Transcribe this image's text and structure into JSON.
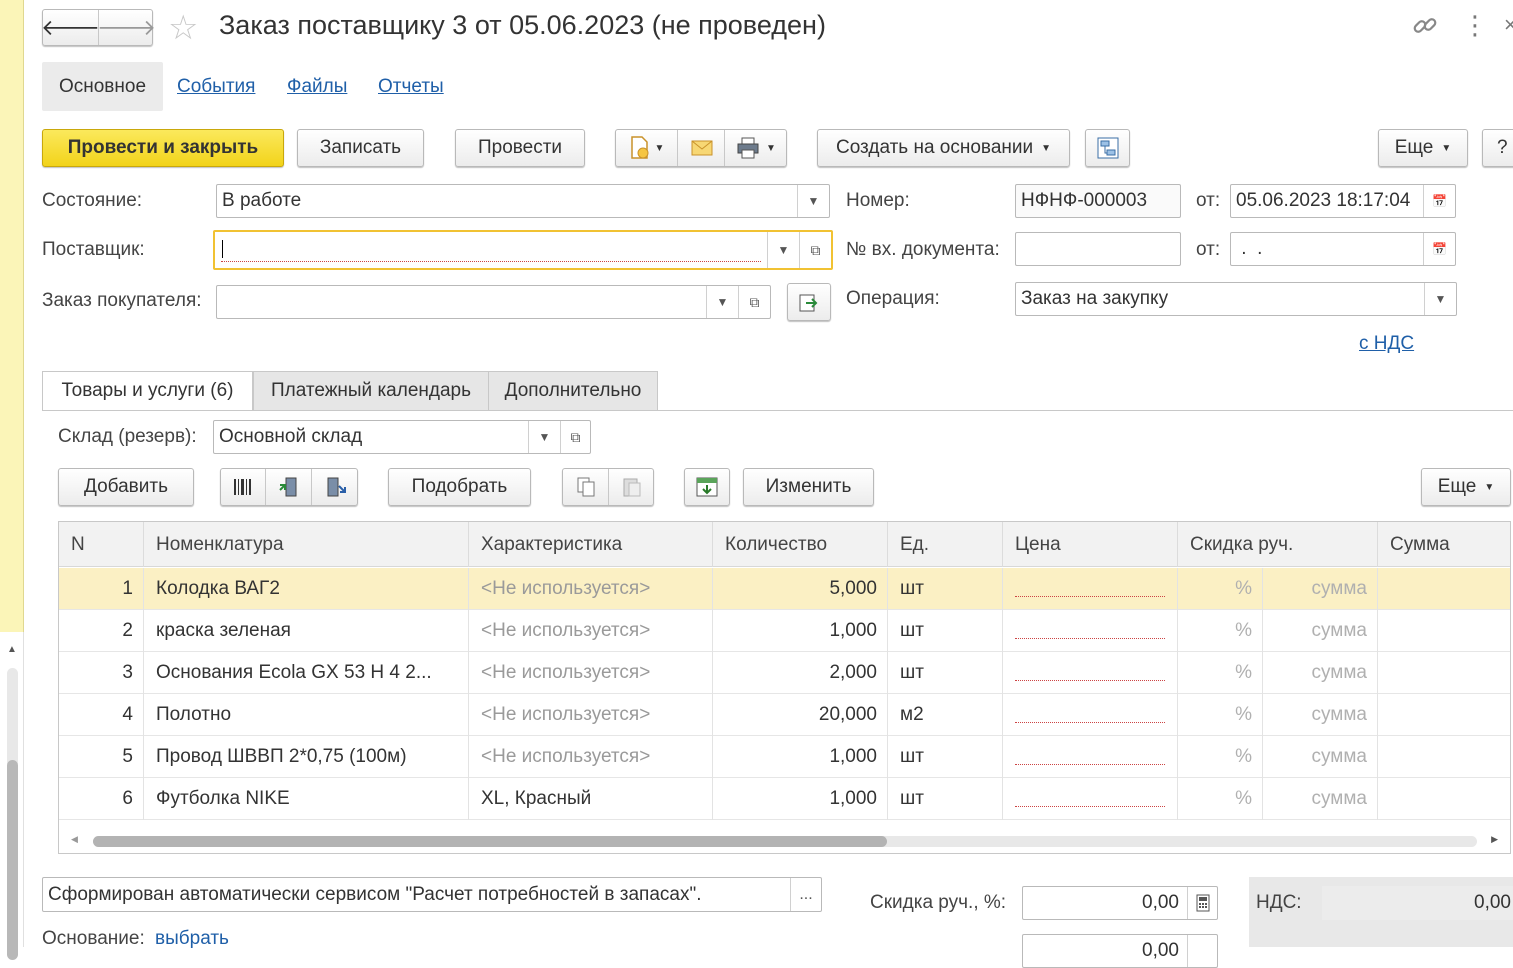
{
  "window": {
    "title": "Заказ поставщику 3 от 05.06.2023 (не проведен)",
    "nav": {
      "back_icon": "arrow-left-icon",
      "forward_icon": "arrow-right-icon"
    },
    "icons": [
      "star-icon",
      "link-icon",
      "more-vertical-icon",
      "close-icon"
    ]
  },
  "section_tabs": [
    {
      "label": "Основное",
      "active": true
    },
    {
      "label": "События",
      "active": false
    },
    {
      "label": "Файлы",
      "active": false
    },
    {
      "label": "Отчеты",
      "active": false
    }
  ],
  "toolbar": {
    "post_close": "Провести и закрыть",
    "save": "Записать",
    "post": "Провести",
    "create_based": "Создать на основании",
    "more": "Еще",
    "help": "?",
    "icons": [
      "document-create-icon",
      "envelope-icon",
      "printer-icon",
      "structure-icon"
    ]
  },
  "form": {
    "state": {
      "label": "Состояние:",
      "value": "В работе"
    },
    "supplier": {
      "label": "Поставщик:",
      "value": ""
    },
    "customer_order": {
      "label": "Заказ покупателя:",
      "value": ""
    },
    "number": {
      "label": "Номер:",
      "value": "НФНФ-000003",
      "from_label": "от:",
      "date": "05.06.2023 18:17:04"
    },
    "incoming_doc": {
      "label": "№ вх. документа:",
      "value": "",
      "from_label": "от:",
      "date": " .  . "
    },
    "operation": {
      "label": "Операция:",
      "value": "Заказ на закупку"
    },
    "vat_link": "с НДС"
  },
  "doc_tabs": [
    {
      "label": "Товары и услуги (6)",
      "active": true
    },
    {
      "label": "Платежный календарь",
      "active": false
    },
    {
      "label": "Дополнительно",
      "active": false
    }
  ],
  "warehouse": {
    "label": "Склад (резерв):",
    "value": "Основной склад"
  },
  "table_toolbar": {
    "add": "Добавить",
    "pick": "Подобрать",
    "change": "Изменить",
    "more": "Еще"
  },
  "table": {
    "columns": [
      "N",
      "Номенклатура",
      "Характеристика",
      "Количество",
      "Ед.",
      "Цена",
      "Скидка руч.",
      "Сумма"
    ],
    "rows": [
      {
        "n": "1",
        "item": "Колодка ВАГ2",
        "char": "<Не используется>",
        "qty": "5,000",
        "unit": "шт",
        "pct": "%",
        "sum": "сумма",
        "selected": true
      },
      {
        "n": "2",
        "item": "краска зеленая",
        "char": "<Не используется>",
        "qty": "1,000",
        "unit": "шт",
        "pct": "%",
        "sum": "сумма",
        "selected": false
      },
      {
        "n": "3",
        "item": "Основания Ecola GX 53 H 4 2...",
        "char": "<Не используется>",
        "qty": "2,000",
        "unit": "шт",
        "pct": "%",
        "sum": "сумма",
        "selected": false
      },
      {
        "n": "4",
        "item": "Полотно",
        "char": "<Не используется>",
        "qty": "20,000",
        "unit": "м2",
        "pct": "%",
        "sum": "сумма",
        "selected": false
      },
      {
        "n": "5",
        "item": "Провод ШВВП 2*0,75 (100м)",
        "char": "<Не используется>",
        "qty": "1,000",
        "unit": "шт",
        "pct": "%",
        "sum": "сумма",
        "selected": false
      },
      {
        "n": "6",
        "item": "Футболка NIKE",
        "char": "XL, Красный",
        "qty": "1,000",
        "unit": "шт",
        "pct": "%",
        "sum": "сумма",
        "selected": false
      }
    ]
  },
  "footer": {
    "comment": "Сформирован автоматически сервисом \"Расчет потребностей в запасах\".",
    "comment_btn": "...",
    "basis_label": "Основание:",
    "basis_link": "выбрать",
    "discount_label": "Скидка руч., %:",
    "discount_value": "0,00",
    "vat_label": "НДС:",
    "vat_value": "0,00",
    "discount2_value": "0,00"
  }
}
